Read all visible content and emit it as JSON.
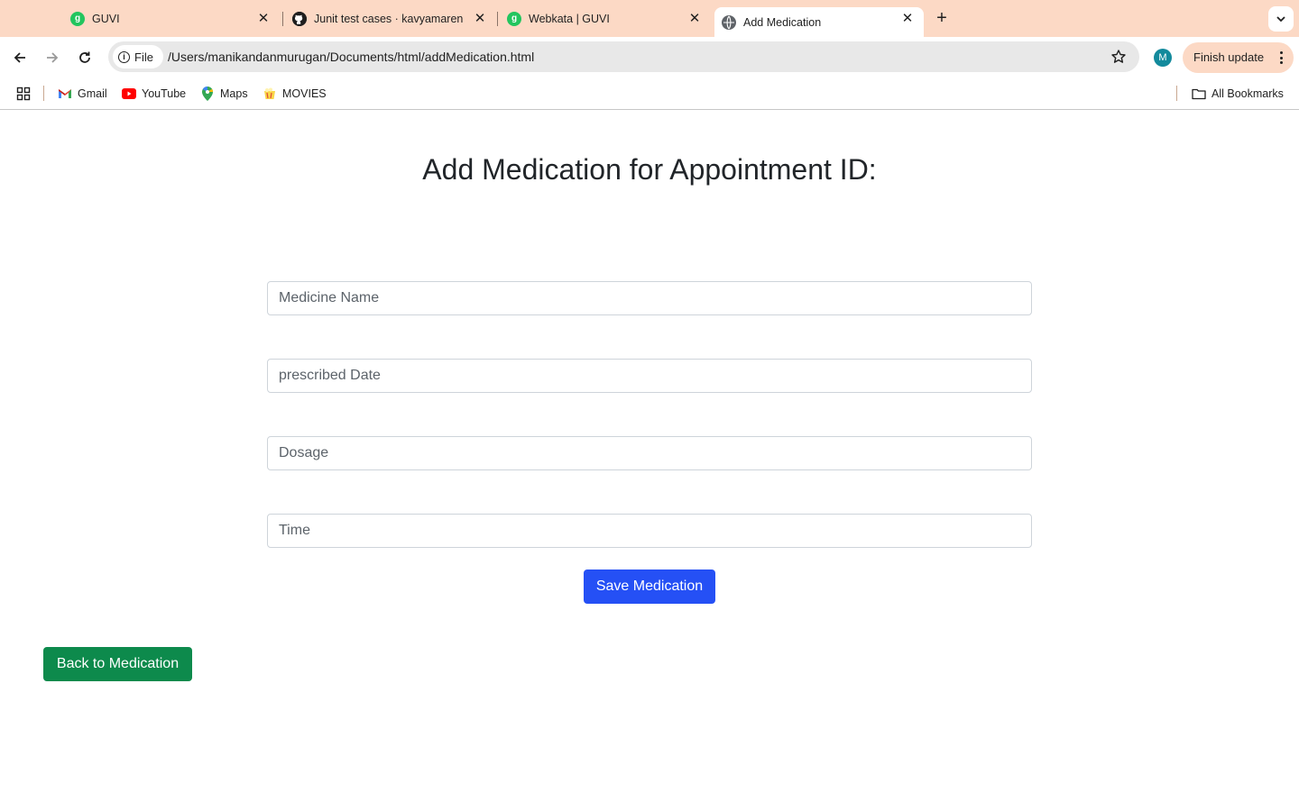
{
  "browser": {
    "tabs": [
      {
        "title": "GUVI",
        "icon": "guvi-icon",
        "active": false
      },
      {
        "title": "Junit test cases · kavyamaren",
        "icon": "github-icon",
        "active": false
      },
      {
        "title": "Webkata | GUVI",
        "icon": "guvi-icon",
        "active": false
      },
      {
        "title": "Add Medication",
        "icon": "globe-icon",
        "active": true
      }
    ],
    "chip_label": "File",
    "url": "/Users/manikandanmurugan/Documents/html/addMedication.html",
    "avatar_letter": "M",
    "finish_update_label": "Finish update",
    "bookmarks": [
      {
        "label": "Gmail",
        "icon": "gmail-icon"
      },
      {
        "label": "YouTube",
        "icon": "youtube-icon"
      },
      {
        "label": "Maps",
        "icon": "maps-icon"
      },
      {
        "label": "MOVIES",
        "icon": "movies-icon"
      }
    ],
    "all_bookmarks_label": "All Bookmarks",
    "colors": {
      "tabstrip": "#fcd9c5",
      "active_tab": "#ffffff"
    }
  },
  "page": {
    "title": "Add Medication for Appointment ID:",
    "fields": {
      "medicine_name": {
        "placeholder": "Medicine Name",
        "value": ""
      },
      "prescribed_date": {
        "placeholder": "prescribed Date",
        "value": ""
      },
      "dosage": {
        "placeholder": "Dosage",
        "value": ""
      },
      "time": {
        "placeholder": "Time",
        "value": ""
      }
    },
    "save_button": "Save Medication",
    "back_button": "Back to Medication",
    "colors": {
      "primary": "#2550f5",
      "success": "#0d8a4c"
    }
  }
}
